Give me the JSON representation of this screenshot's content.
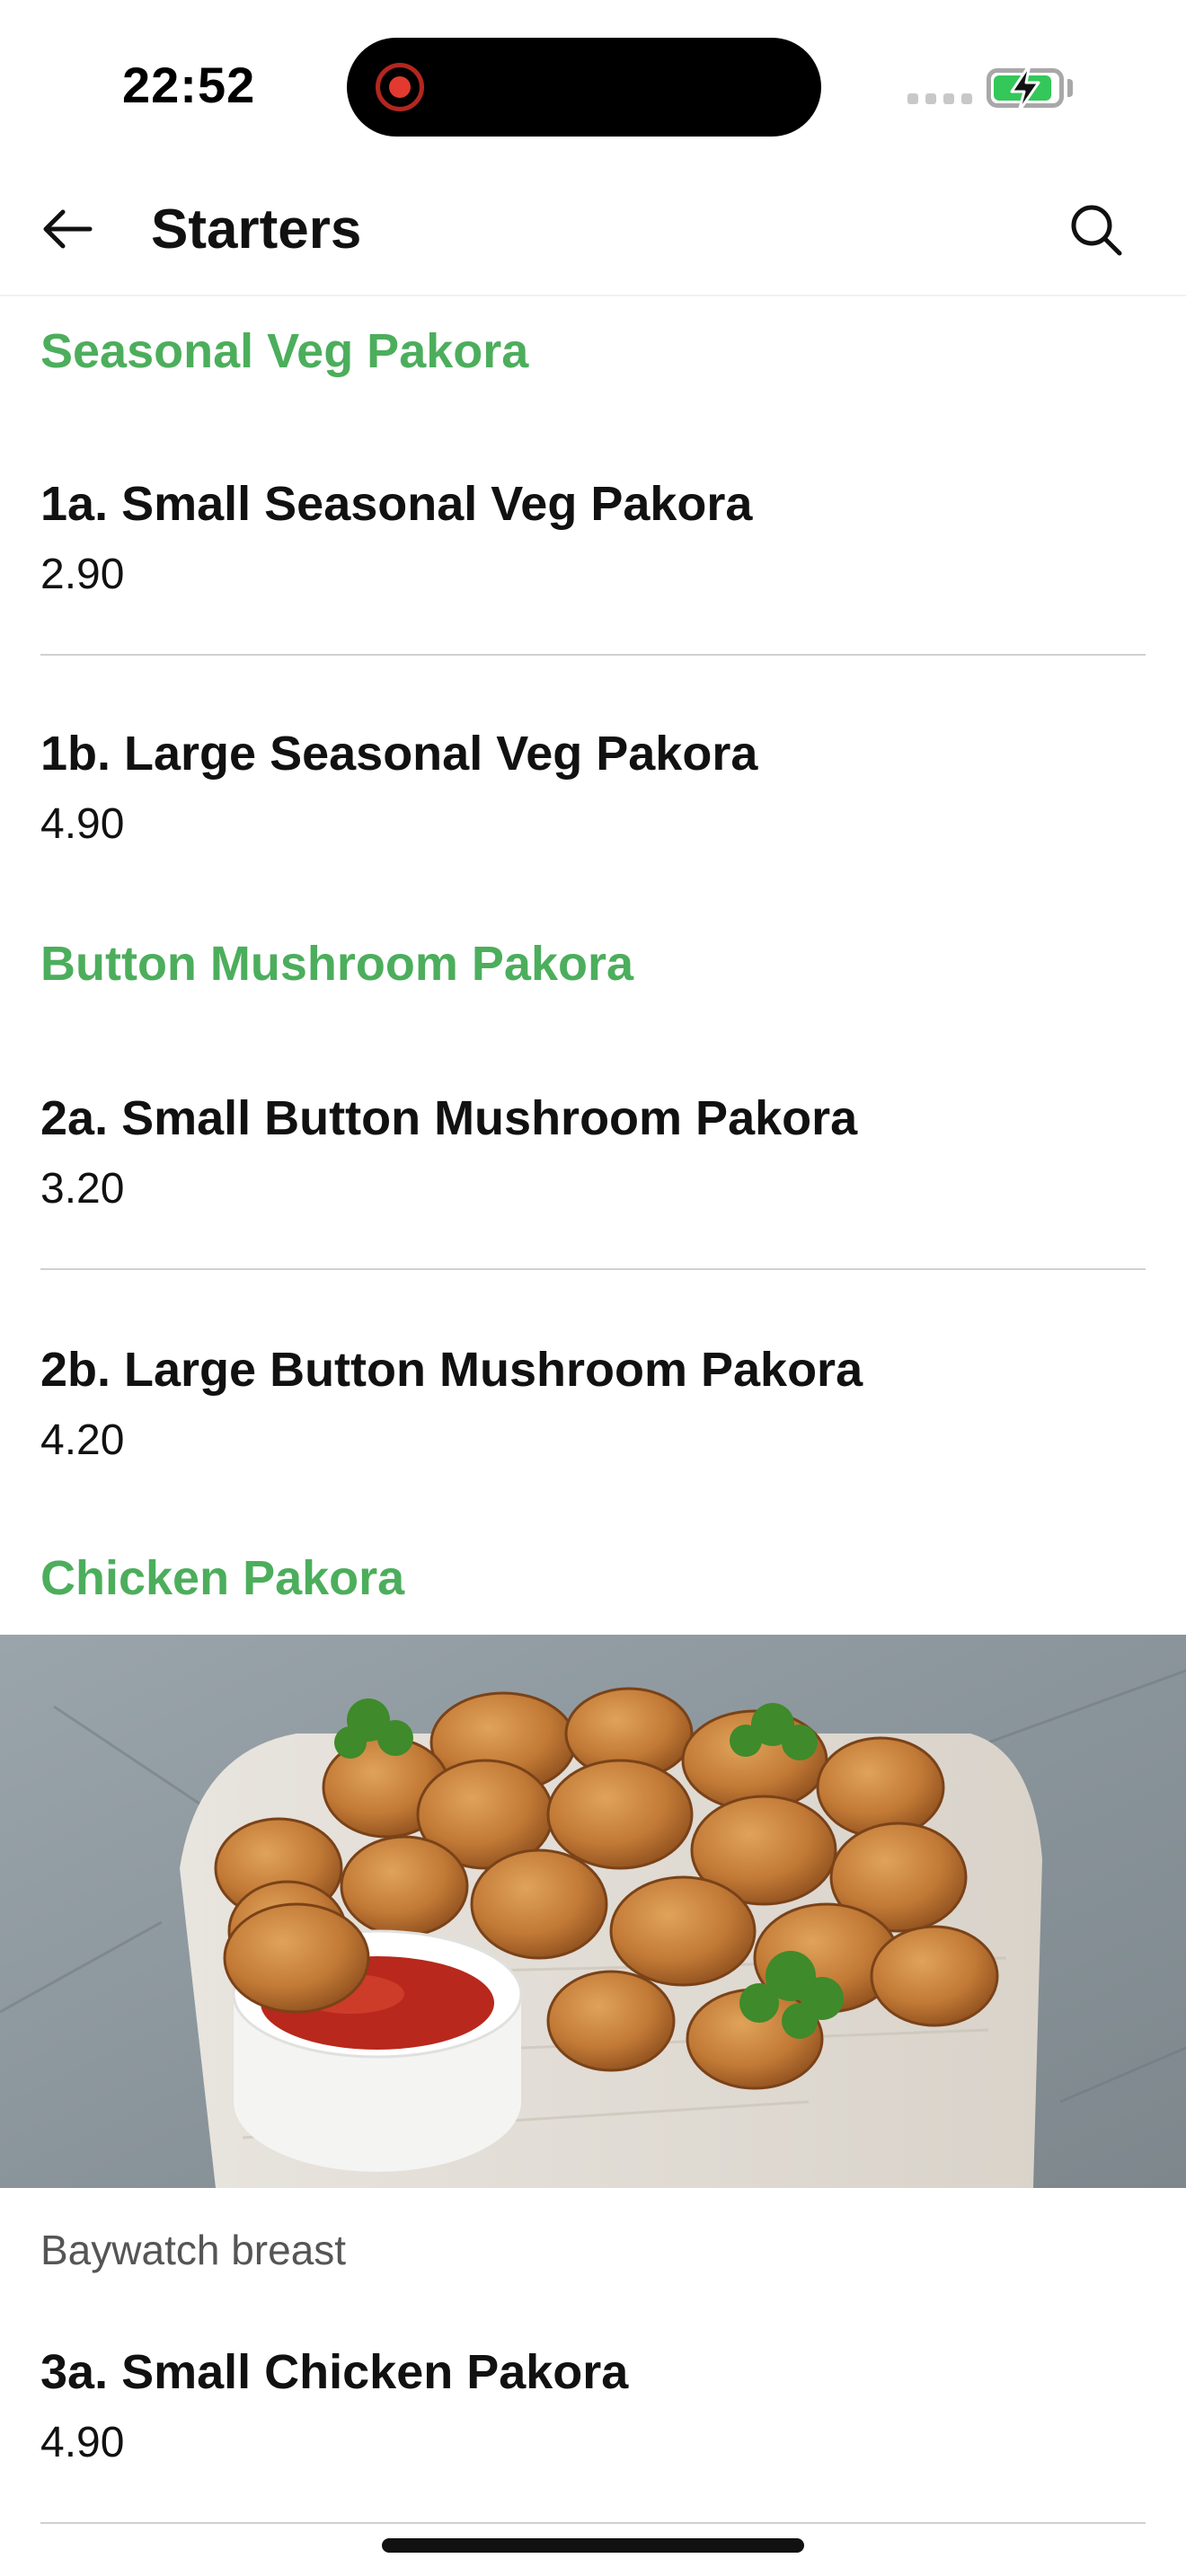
{
  "status_bar": {
    "time": "22:52"
  },
  "header": {
    "title": "Starters",
    "back_icon": "arrow-left-icon",
    "search_icon": "search-icon"
  },
  "sections": [
    {
      "title": "Seasonal Veg Pakora",
      "items": [
        {
          "name": "1a. Small Seasonal Veg Pakora",
          "price": "2.90"
        },
        {
          "name": "1b. Large Seasonal Veg Pakora",
          "price": "4.90"
        }
      ]
    },
    {
      "title": "Button Mushroom Pakora",
      "items": [
        {
          "name": "2a. Small Button Mushroom Pakora",
          "price": "3.20"
        },
        {
          "name": "2b. Large Button Mushroom Pakora",
          "price": "4.20"
        }
      ]
    },
    {
      "title": "Chicken Pakora",
      "description": "Baywatch breast",
      "items": [
        {
          "name": "3a. Small Chicken Pakora",
          "price": "4.90"
        }
      ]
    }
  ],
  "colors": {
    "accent_green": "#4cae5c",
    "battery_green": "#34c759"
  }
}
